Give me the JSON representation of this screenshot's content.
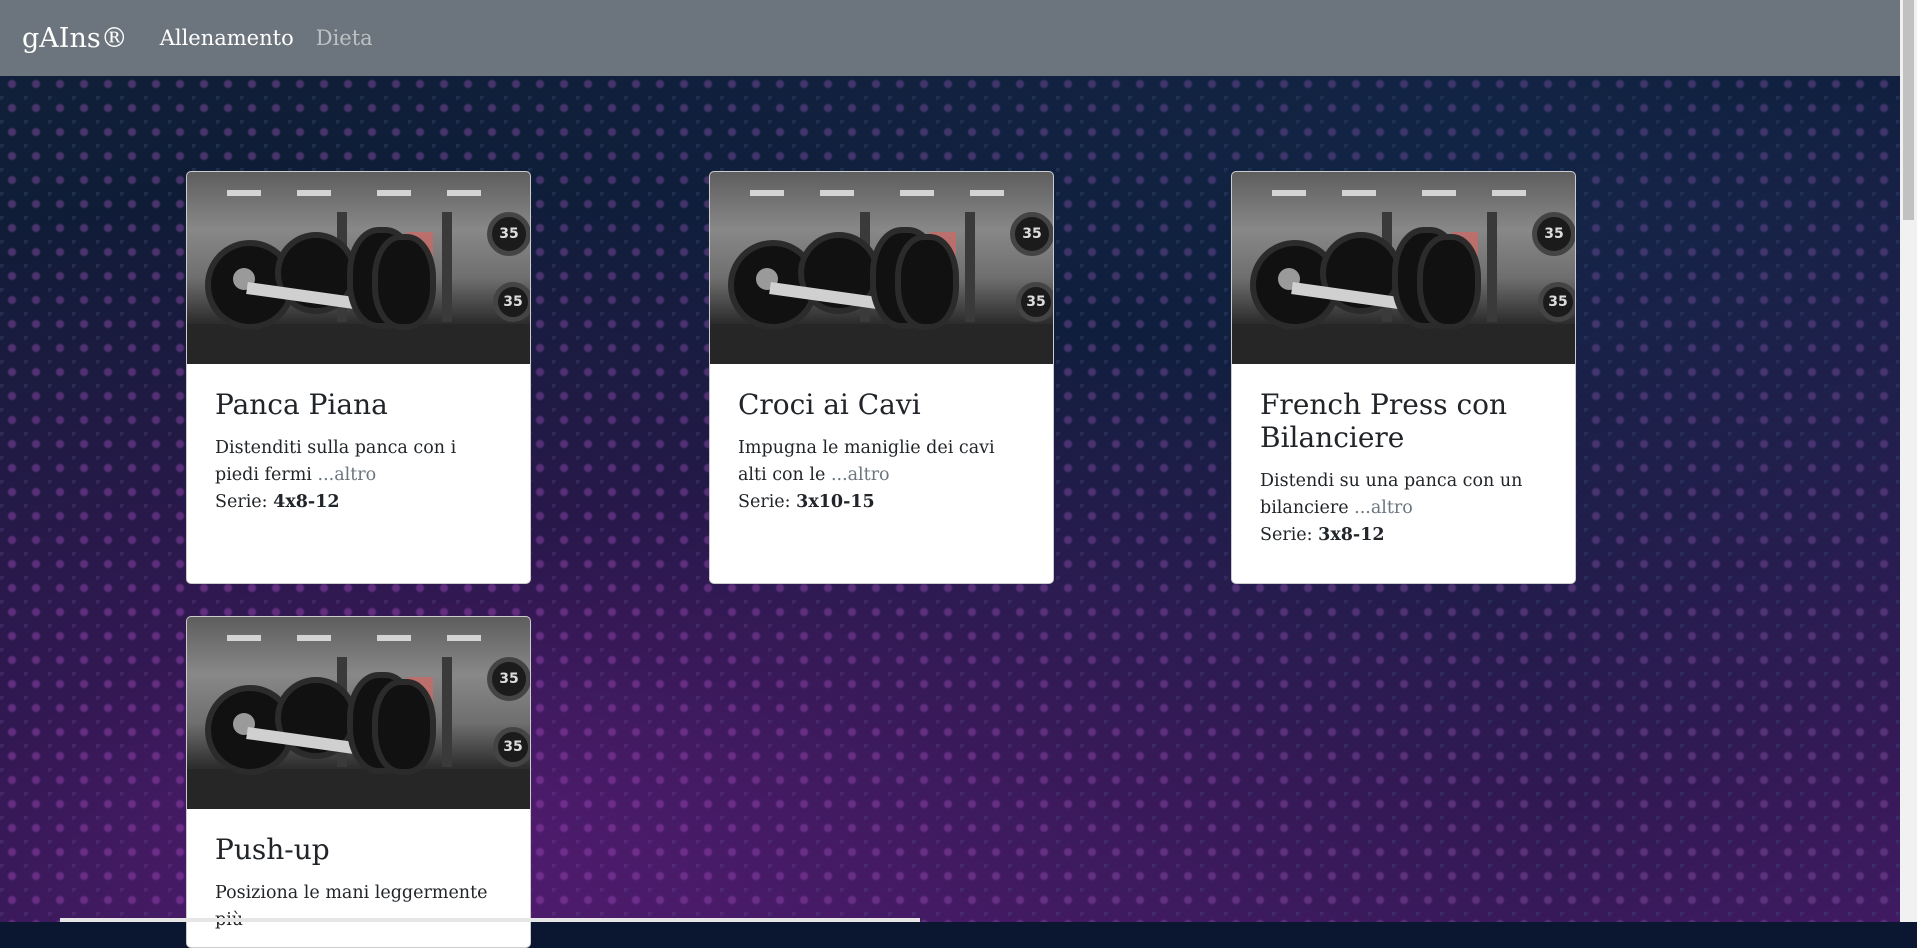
{
  "navbar": {
    "brand": "gAIns®",
    "links": [
      {
        "label": "Allenamento",
        "active": true
      },
      {
        "label": "Dieta",
        "active": false
      }
    ]
  },
  "cards": [
    {
      "title": "Panca Piana",
      "description": "Distenditi sulla panca con i piedi fermi",
      "more": "...altro",
      "serie_label": "Serie:",
      "serie_value": "4x8-12"
    },
    {
      "title": "Croci ai Cavi",
      "description": "Impugna le maniglie dei cavi alti con le",
      "more": "...altro",
      "serie_label": "Serie:",
      "serie_value": "3x10-15"
    },
    {
      "title": "French Press con Bilanciere",
      "description": "Distendi su una panca con un bilanciere",
      "more": "...altro",
      "serie_label": "Serie:",
      "serie_value": "3x8-12"
    },
    {
      "title": "Push-up",
      "description": "Posiziona le mani leggermente più",
      "more": "",
      "serie_label": "",
      "serie_value": ""
    }
  ],
  "image": {
    "icon": "dumbbell-gym-photo",
    "plate_label": "35"
  },
  "colors": {
    "navbar": "#6c757d",
    "card": "#ffffff",
    "text": "#212529",
    "muted": "#6c757d"
  }
}
